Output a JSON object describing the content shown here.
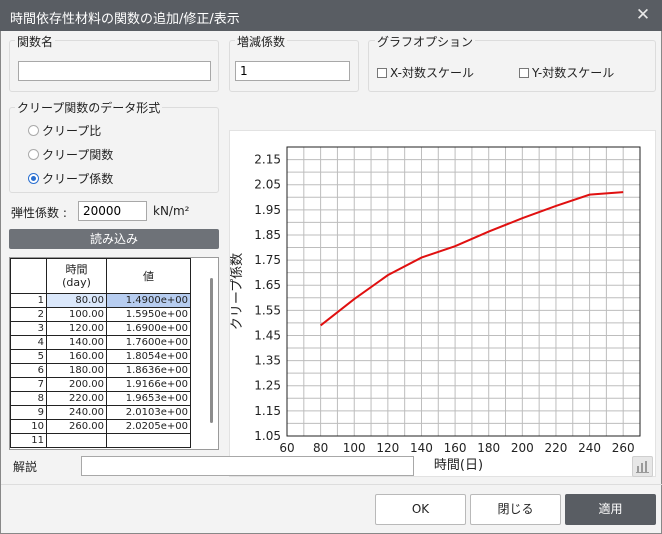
{
  "window": {
    "title": "時間依存性材料の関数の追加/修正/表示",
    "close_glyph": "✕"
  },
  "function_name": {
    "label": "関数名",
    "value": ""
  },
  "scale_factor": {
    "label": "増減係数",
    "value": "1"
  },
  "graph_options": {
    "label": "グラフオプション",
    "x_log": "X-対数スケール",
    "y_log": "Y-対数スケール"
  },
  "creep_format": {
    "label": "クリープ関数のデータ形式",
    "options": [
      "クリープ比",
      "クリープ関数",
      "クリープ係数"
    ],
    "selected": "クリープ係数"
  },
  "elastic_modulus": {
    "label": "弾性係数 :",
    "value": "20000",
    "unit": "kN/m²"
  },
  "load_button": "読み込み",
  "table": {
    "headers": [
      "時間\n(day)",
      "値"
    ],
    "rows": [
      {
        "n": "1",
        "time": "80.00",
        "value": "1.4900e+00"
      },
      {
        "n": "2",
        "time": "100.00",
        "value": "1.5950e+00"
      },
      {
        "n": "3",
        "time": "120.00",
        "value": "1.6900e+00"
      },
      {
        "n": "4",
        "time": "140.00",
        "value": "1.7600e+00"
      },
      {
        "n": "5",
        "time": "160.00",
        "value": "1.8054e+00"
      },
      {
        "n": "6",
        "time": "180.00",
        "value": "1.8636e+00"
      },
      {
        "n": "7",
        "time": "200.00",
        "value": "1.9166e+00"
      },
      {
        "n": "8",
        "time": "220.00",
        "value": "1.9653e+00"
      },
      {
        "n": "9",
        "time": "240.00",
        "value": "2.0103e+00"
      },
      {
        "n": "10",
        "time": "260.00",
        "value": "2.0205e+00"
      },
      {
        "n": "11",
        "time": "",
        "value": ""
      }
    ]
  },
  "chart_data": {
    "type": "line",
    "title": "",
    "xlabel": "時間(日)",
    "ylabel": "クリープ係数",
    "x": [
      80,
      100,
      120,
      140,
      160,
      180,
      200,
      220,
      240,
      260
    ],
    "series": [
      {
        "values": [
          1.49,
          1.595,
          1.69,
          1.76,
          1.8054,
          1.8636,
          1.9166,
          1.9653,
          2.0103,
          2.0205
        ],
        "color": "#e01010"
      }
    ],
    "xlim": [
      60,
      270
    ],
    "ylim": [
      1.05,
      2.2
    ],
    "xticks": [
      60,
      80,
      100,
      120,
      140,
      160,
      180,
      200,
      220,
      240,
      260
    ],
    "yticks": [
      1.05,
      1.15,
      1.25,
      1.35,
      1.45,
      1.55,
      1.65,
      1.75,
      1.85,
      1.95,
      2.05,
      2.15
    ],
    "grid": true
  },
  "description": {
    "label": "解説",
    "value": ""
  },
  "buttons": {
    "ok": "OK",
    "close": "閉じる",
    "apply": "適用"
  },
  "colors": {
    "title_bar": "#595d63",
    "selection": "#b7cdf0",
    "line": "#e01010"
  }
}
